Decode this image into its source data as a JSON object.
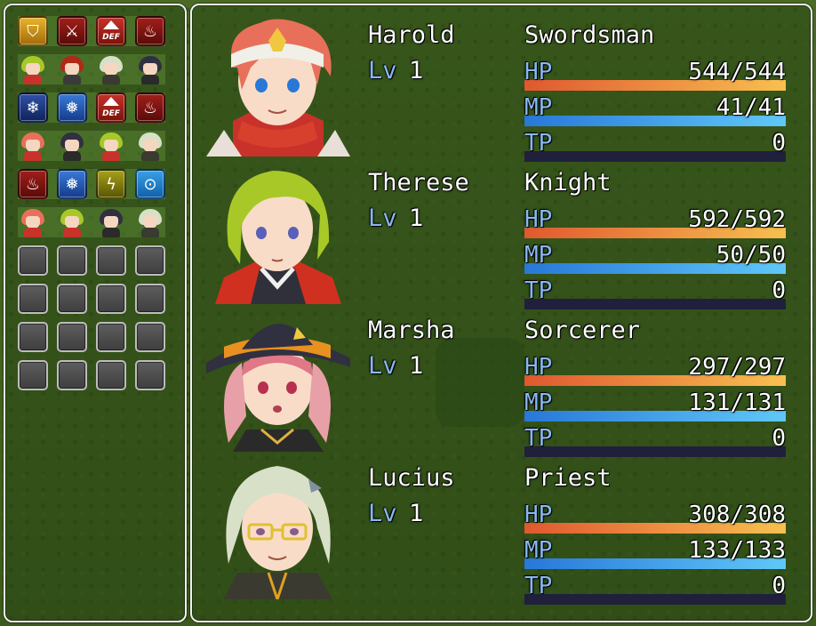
{
  "colors": {
    "hp": "#f0a040",
    "mp": "#40a0e8",
    "tp": "#20203c",
    "system": "#88b8f0",
    "window_border": "#f0f0f0"
  },
  "left_panel": {
    "rows": [
      {
        "kind": "skills",
        "items": [
          "shield-icon",
          "sword-break-icon",
          "def-up-icon",
          "fire-icon"
        ]
      },
      {
        "kind": "faces",
        "items": [
          "therese-face",
          "red-haired-boy-face",
          "lucius-face",
          "marsha-face"
        ]
      },
      {
        "kind": "skills",
        "items": [
          "ice-shard-icon",
          "snowflake-icon",
          "def-up-icon",
          "fire-icon"
        ]
      },
      {
        "kind": "faces",
        "items": [
          "harold-face",
          "marsha-face",
          "therese-face",
          "lucius-face"
        ]
      },
      {
        "kind": "skills",
        "items": [
          "fire-icon",
          "snowflake-icon",
          "lightning-icon",
          "water-drop-icon"
        ]
      },
      {
        "kind": "faces",
        "items": [
          "harold-face",
          "therese-face",
          "marsha-face",
          "lucius-face"
        ]
      },
      {
        "kind": "empty",
        "items": [
          "",
          "",
          "",
          ""
        ]
      },
      {
        "kind": "empty",
        "items": [
          "",
          "",
          "",
          ""
        ]
      },
      {
        "kind": "empty",
        "items": [
          "",
          "",
          "",
          ""
        ]
      },
      {
        "kind": "empty",
        "items": [
          "",
          "",
          "",
          ""
        ]
      }
    ],
    "def_label": "DEF"
  },
  "labels": {
    "lv": "Lv",
    "hp": "HP",
    "mp": "MP",
    "tp": "TP"
  },
  "actors": [
    {
      "name": "Harold",
      "class": "Swordsman",
      "level": "1",
      "hp": "544/544",
      "mp": "41/41",
      "tp": "0",
      "hp_rate": 1,
      "mp_rate": 1,
      "tp_rate": 0
    },
    {
      "name": "Therese",
      "class": "Knight",
      "level": "1",
      "hp": "592/592",
      "mp": "50/50",
      "tp": "0",
      "hp_rate": 1,
      "mp_rate": 1,
      "tp_rate": 0
    },
    {
      "name": "Marsha",
      "class": "Sorcerer",
      "level": "1",
      "hp": "297/297",
      "mp": "131/131",
      "tp": "0",
      "hp_rate": 1,
      "mp_rate": 1,
      "tp_rate": 0
    },
    {
      "name": "Lucius",
      "class": "Priest",
      "level": "1",
      "hp": "308/308",
      "mp": "133/133",
      "tp": "0",
      "hp_rate": 1,
      "mp_rate": 1,
      "tp_rate": 0
    }
  ]
}
